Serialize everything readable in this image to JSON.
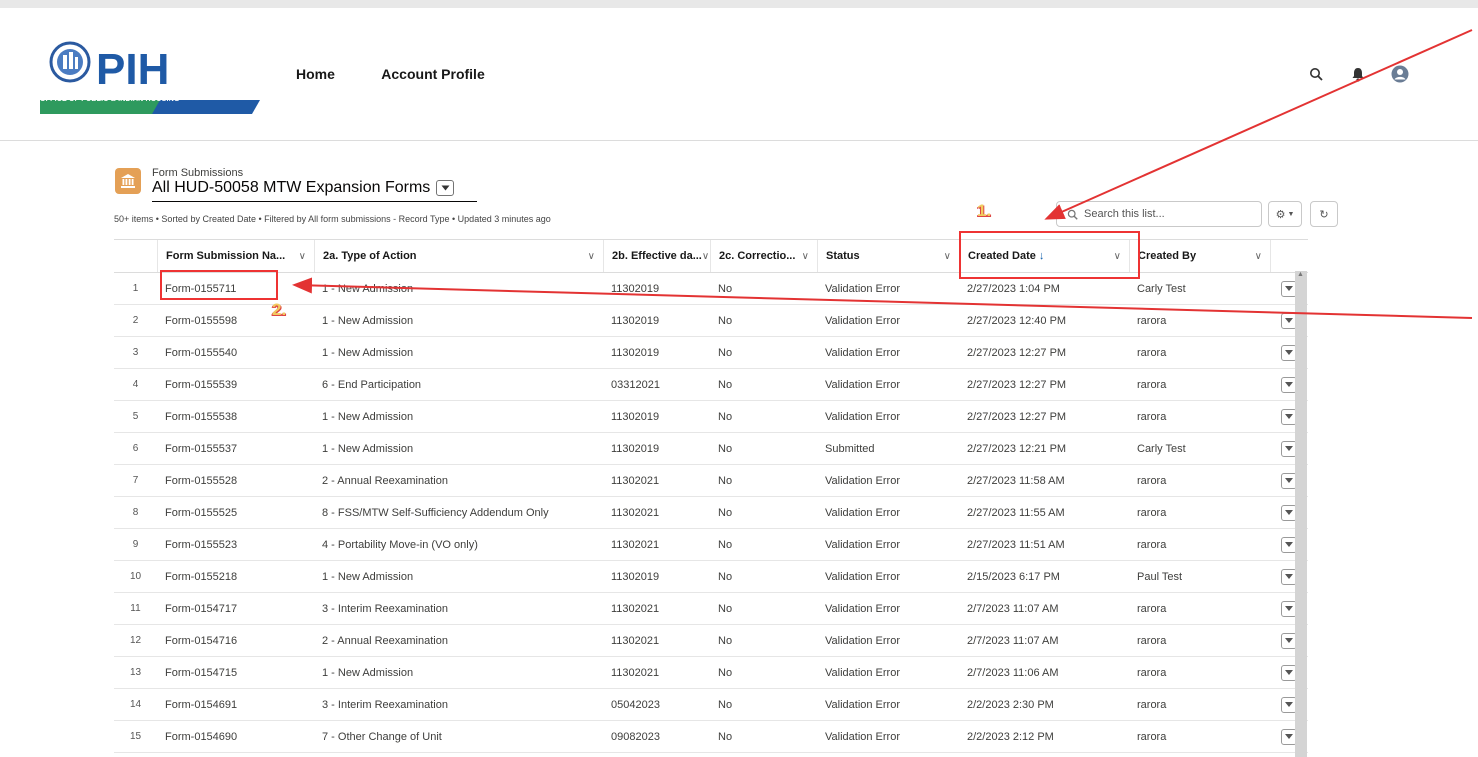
{
  "header": {
    "logo_text": "PIH",
    "logo_subtitle": "OFFICE OF PUBLIC & INDIAN HOUSING",
    "nav": [
      "Home",
      "Account Profile"
    ]
  },
  "list": {
    "object_label": "Form Submissions",
    "title": "All HUD-50058 MTW Expansion Forms",
    "meta": "50+ items • Sorted by Created Date • Filtered by All form submissions - Record Type • Updated 3 minutes ago",
    "search_placeholder": "Search this list..."
  },
  "annotations": {
    "label1": "1.",
    "label2": "2."
  },
  "table": {
    "columns": [
      "Form Submission Na...",
      "2a. Type of Action",
      "2b. Effective da...",
      "2c. Correctio...",
      "Status",
      "Created Date",
      "Created By"
    ],
    "sort_indicator": "↓",
    "rows": [
      {
        "n": "1",
        "name": "Form-0155711",
        "action": "1 - New Admission",
        "eff": "11302019",
        "corr": "No",
        "status": "Validation Error",
        "created": "2/27/2023 1:04 PM",
        "by": "Carly Test"
      },
      {
        "n": "2",
        "name": "Form-0155598",
        "action": "1 - New Admission",
        "eff": "11302019",
        "corr": "No",
        "status": "Validation Error",
        "created": "2/27/2023 12:40 PM",
        "by": "rarora"
      },
      {
        "n": "3",
        "name": "Form-0155540",
        "action": "1 - New Admission",
        "eff": "11302019",
        "corr": "No",
        "status": "Validation Error",
        "created": "2/27/2023 12:27 PM",
        "by": "rarora"
      },
      {
        "n": "4",
        "name": "Form-0155539",
        "action": "6 - End Participation",
        "eff": "03312021",
        "corr": "No",
        "status": "Validation Error",
        "created": "2/27/2023 12:27 PM",
        "by": "rarora"
      },
      {
        "n": "5",
        "name": "Form-0155538",
        "action": "1 - New Admission",
        "eff": "11302019",
        "corr": "No",
        "status": "Validation Error",
        "created": "2/27/2023 12:27 PM",
        "by": "rarora"
      },
      {
        "n": "6",
        "name": "Form-0155537",
        "action": "1 - New Admission",
        "eff": "11302019",
        "corr": "No",
        "status": "Submitted",
        "created": "2/27/2023 12:21 PM",
        "by": "Carly Test"
      },
      {
        "n": "7",
        "name": "Form-0155528",
        "action": "2 - Annual Reexamination",
        "eff": "11302021",
        "corr": "No",
        "status": "Validation Error",
        "created": "2/27/2023 11:58 AM",
        "by": "rarora"
      },
      {
        "n": "8",
        "name": "Form-0155525",
        "action": "8 - FSS/MTW Self-Sufficiency Addendum Only",
        "eff": "11302021",
        "corr": "No",
        "status": "Validation Error",
        "created": "2/27/2023 11:55 AM",
        "by": "rarora"
      },
      {
        "n": "9",
        "name": "Form-0155523",
        "action": "4 - Portability Move-in (VO only)",
        "eff": "11302021",
        "corr": "No",
        "status": "Validation Error",
        "created": "2/27/2023 11:51 AM",
        "by": "rarora"
      },
      {
        "n": "10",
        "name": "Form-0155218",
        "action": "1 - New Admission",
        "eff": "11302019",
        "corr": "No",
        "status": "Validation Error",
        "created": "2/15/2023 6:17 PM",
        "by": "Paul Test"
      },
      {
        "n": "11",
        "name": "Form-0154717",
        "action": "3 - Interim Reexamination",
        "eff": "11302021",
        "corr": "No",
        "status": "Validation Error",
        "created": "2/7/2023 11:07 AM",
        "by": "rarora"
      },
      {
        "n": "12",
        "name": "Form-0154716",
        "action": "2 - Annual Reexamination",
        "eff": "11302021",
        "corr": "No",
        "status": "Validation Error",
        "created": "2/7/2023 11:07 AM",
        "by": "rarora"
      },
      {
        "n": "13",
        "name": "Form-0154715",
        "action": "1 - New Admission",
        "eff": "11302021",
        "corr": "No",
        "status": "Validation Error",
        "created": "2/7/2023 11:06 AM",
        "by": "rarora"
      },
      {
        "n": "14",
        "name": "Form-0154691",
        "action": "3 - Interim Reexamination",
        "eff": "05042023",
        "corr": "No",
        "status": "Validation Error",
        "created": "2/2/2023 2:30 PM",
        "by": "rarora"
      },
      {
        "n": "15",
        "name": "Form-0154690",
        "action": "7 - Other Change of Unit",
        "eff": "09082023",
        "corr": "No",
        "status": "Validation Error",
        "created": "2/2/2023 2:12 PM",
        "by": "rarora"
      }
    ]
  },
  "colors": {
    "annotation_red": "#e33333",
    "annotation_label": "#f2cb60",
    "object_icon": "#e4a056",
    "logo_blue": "#1f5aa6",
    "logo_green": "#2e8b57"
  }
}
